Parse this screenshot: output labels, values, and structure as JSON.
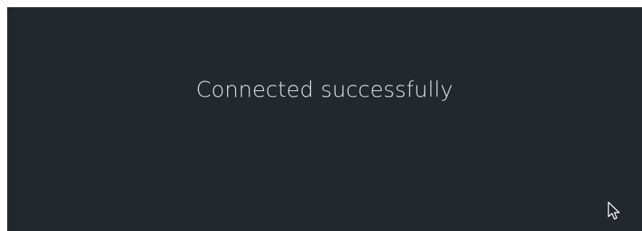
{
  "screen": {
    "message": "Connected successfully",
    "background_color": "#22282e",
    "text_color": "#e3e6e8"
  },
  "pointer": {
    "icon": "mouse-pointer-icon"
  }
}
